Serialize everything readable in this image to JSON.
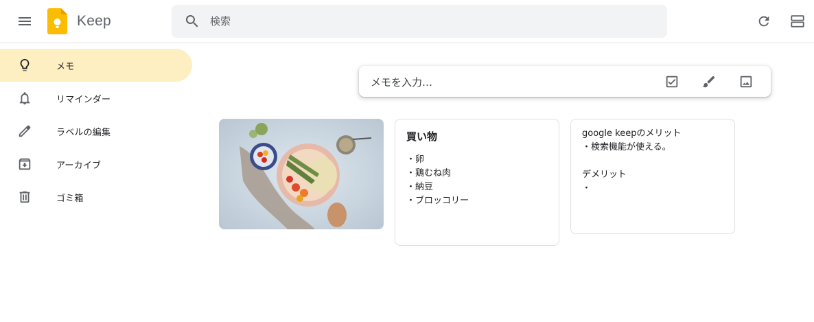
{
  "header": {
    "app_title": "Keep",
    "search_placeholder": "検索"
  },
  "sidebar": {
    "items": [
      {
        "label": "メモ",
        "icon": "lightbulb-icon",
        "active": true
      },
      {
        "label": "リマインダー",
        "icon": "bell-icon",
        "active": false
      },
      {
        "label": "ラベルの編集",
        "icon": "pencil-icon",
        "active": false
      },
      {
        "label": "アーカイブ",
        "icon": "archive-icon",
        "active": false
      },
      {
        "label": "ゴミ箱",
        "icon": "trash-icon",
        "active": false
      }
    ]
  },
  "take_note": {
    "placeholder": "メモを入力…",
    "actions": [
      "checkbox-icon",
      "brush-icon",
      "image-icon"
    ]
  },
  "notes": [
    {
      "type": "image",
      "alt": "food-photo"
    },
    {
      "title": "買い物",
      "body": "・卵\n・鶏むね肉\n・納豆\n・ブロッコリー"
    },
    {
      "title": "",
      "body": "google keepのメリット\n・検索機能が使える。\n\nデメリット\n・"
    }
  ],
  "colors": {
    "accent_active": "#feefc3",
    "logo_yellow": "#fbbc04",
    "search_bg": "#f1f3f4"
  }
}
